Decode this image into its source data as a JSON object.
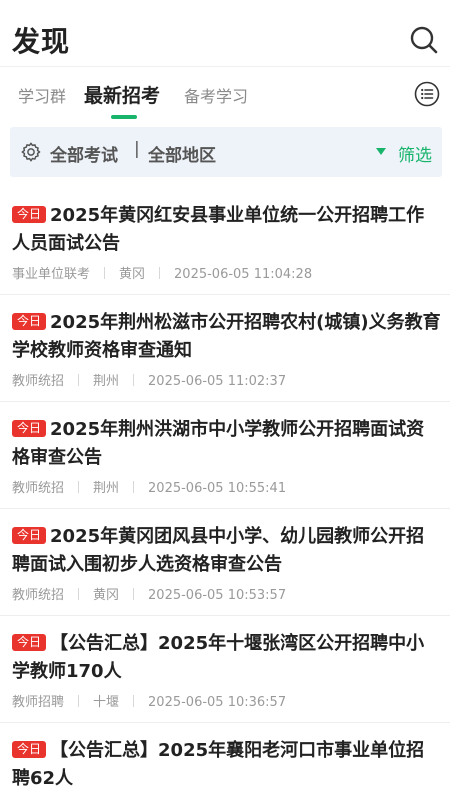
{
  "header": {
    "title": "发现",
    "search_icon": "search-icon"
  },
  "tabs": [
    {
      "label": "学习群",
      "active": false
    },
    {
      "label": "最新招考",
      "active": true
    },
    {
      "label": "备考学习",
      "active": false
    }
  ],
  "filters": {
    "exam": "全部考试",
    "separator": "|",
    "region": "全部地区",
    "screen": "筛选"
  },
  "colors": {
    "accent": "#18b46b",
    "badge": "#e8342d",
    "filter_bg": "#eef3f9"
  },
  "items": [
    {
      "badge": "今日",
      "title": "2025年黄冈红安县事业单位统一公开招聘工作人员面试公告",
      "category": "事业单位联考",
      "region": "黄冈",
      "time": "2025-06-05 11:04:28"
    },
    {
      "badge": "今日",
      "title": "2025年荆州松滋市公开招聘农村(城镇)义务教育学校教师资格审查通知",
      "category": "教师统招",
      "region": "荆州",
      "time": "2025-06-05 11:02:37"
    },
    {
      "badge": "今日",
      "title": "2025年荆州洪湖市中小学教师公开招聘面试资格审查公告",
      "category": "教师统招",
      "region": "荆州",
      "time": "2025-06-05 10:55:41"
    },
    {
      "badge": "今日",
      "title": "2025年黄冈团风县中小学、幼儿园教师公开招聘面试入围初步人选资格审查公告",
      "category": "教师统招",
      "region": "黄冈",
      "time": "2025-06-05 10:53:57"
    },
    {
      "badge": "今日",
      "title": "【公告汇总】2025年十堰张湾区公开招聘中小学教师170人",
      "category": "教师招聘",
      "region": "十堰",
      "time": "2025-06-05 10:36:57"
    },
    {
      "badge": "今日",
      "title": "【公告汇总】2025年襄阳老河口市事业单位招聘62人",
      "category": "",
      "region": "",
      "time": ""
    }
  ]
}
